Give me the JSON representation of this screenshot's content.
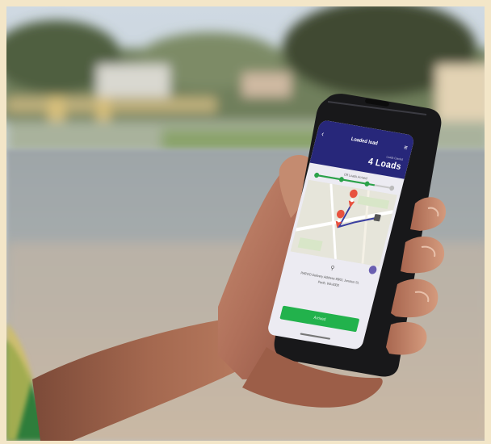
{
  "photo": {
    "description_colors": {
      "frame": "#f3e6c8",
      "road": "#9aa3a8",
      "sky": "#c9d4de",
      "skin": "#b07358",
      "phone_body": "#1c1c1e",
      "app_header": "#27277a",
      "action_button": "#22b24c"
    }
  },
  "app": {
    "header": {
      "title": "Loaded load",
      "subtitle": "Loads Carried",
      "count": "4 Loads",
      "back_icon": "chevron-left-icon",
      "menu_icon": "menu-icon"
    },
    "progress": {
      "label": "Off Loads Arrived",
      "fraction": 0.75,
      "steps": 4,
      "completed": 3
    },
    "map": {
      "pins": 2,
      "pin_color": "#e8523f",
      "route_color": "#3a3fa0"
    },
    "delivery": {
      "pin_icon": "location-pin-icon",
      "address_line1": "PAROO Delivery Address 99/01 Jonutun St,",
      "address_line2": "Perth, WA 6000"
    },
    "action": {
      "label": "Arrived"
    }
  }
}
